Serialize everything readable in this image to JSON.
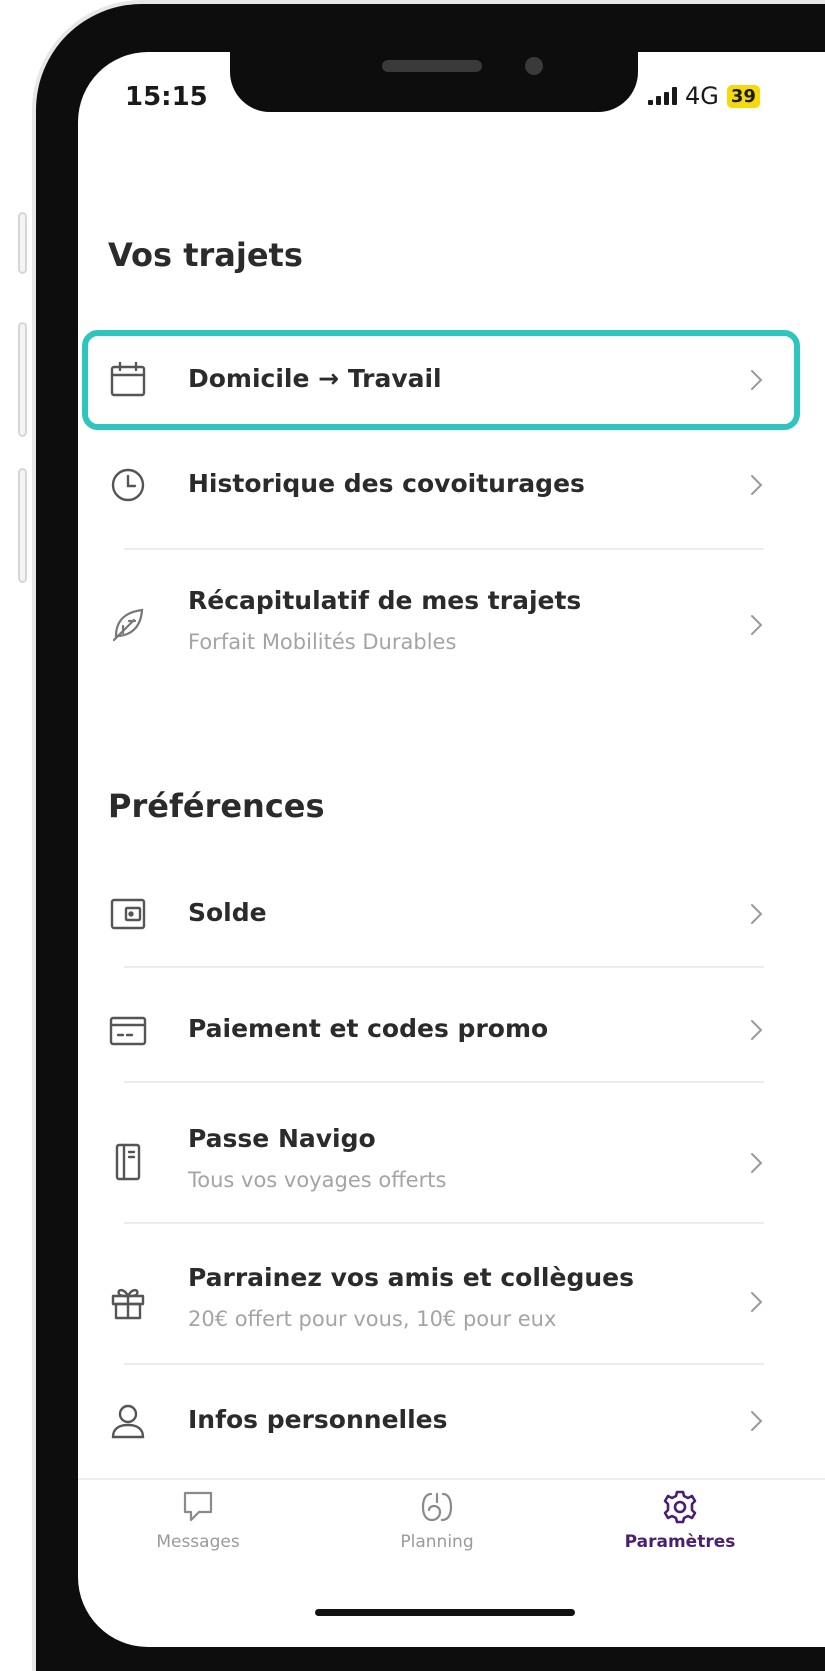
{
  "status": {
    "time": "15:15",
    "network": "4G",
    "battery": "39"
  },
  "sections": [
    {
      "title": "Vos trajets",
      "items": [
        {
          "icon": "calendar-icon",
          "title": "Domicile → Travail",
          "subtitle": ""
        },
        {
          "icon": "clock-icon",
          "title": "Historique des covoiturages",
          "subtitle": ""
        },
        {
          "icon": "leaf-icon",
          "title": "Récapitulatif de mes trajets",
          "subtitle": "Forfait Mobilités Durables"
        }
      ]
    },
    {
      "title": "Préférences",
      "items": [
        {
          "icon": "wallet-icon",
          "title": "Solde",
          "subtitle": ""
        },
        {
          "icon": "credit-card-icon",
          "title": "Paiement et codes promo",
          "subtitle": ""
        },
        {
          "icon": "navigo-pass-icon",
          "title": "Passe Navigo",
          "subtitle": "Tous vos voyages offerts"
        },
        {
          "icon": "gift-icon",
          "title": "Parrainez vos amis et collègues",
          "subtitle": "20€ offert pour vous, 10€ pour eux"
        },
        {
          "icon": "user-icon",
          "title": "Infos personnelles",
          "subtitle": ""
        }
      ]
    }
  ],
  "tabs": [
    {
      "label": "Messages",
      "icon": "chat-icon",
      "active": false
    },
    {
      "label": "Planning",
      "icon": "planning-icon",
      "active": false
    },
    {
      "label": "Paramètres",
      "icon": "gear-icon",
      "active": true
    }
  ],
  "colors": {
    "highlight": "#2ec5bf",
    "active_tab": "#4b1f6f",
    "battery": "#f5d90a"
  }
}
